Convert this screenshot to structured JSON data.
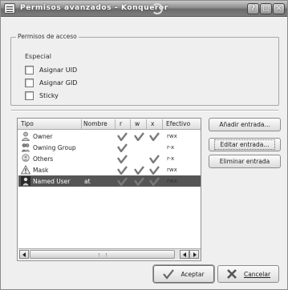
{
  "window": {
    "title": "Permisos avanzados - Konqueror",
    "buttons": {
      "help": "?",
      "maximize": "□",
      "close": "✕"
    }
  },
  "access_group": {
    "title": "Permisos de acceso",
    "special_label": "Especial",
    "checkboxes": [
      {
        "label": "Asignar UID",
        "checked": false
      },
      {
        "label": "Asignar GID",
        "checked": false
      },
      {
        "label": "Sticky",
        "checked": false
      }
    ]
  },
  "table": {
    "columns": [
      "Tipo",
      "Nombre",
      "r",
      "w",
      "x",
      "Efectivo"
    ],
    "rows": [
      {
        "tipo": "Owner",
        "nombre": "",
        "r": true,
        "w": true,
        "x": true,
        "efectivo": "rwx",
        "icon": "user-icon",
        "selected": false
      },
      {
        "tipo": "Owning Group",
        "nombre": "",
        "r": true,
        "w": false,
        "x": false,
        "efectivo": "r-x",
        "icon": "group-icon",
        "selected": false
      },
      {
        "tipo": "Others",
        "nombre": "",
        "r": true,
        "w": false,
        "x": true,
        "efectivo": "r-x",
        "icon": "others-icon",
        "selected": false
      },
      {
        "tipo": "Mask",
        "nombre": "",
        "r": true,
        "w": true,
        "x": true,
        "efectivo": "rwx",
        "icon": "warning-icon",
        "selected": false
      },
      {
        "tipo": "Named User",
        "nombre": "at",
        "r": true,
        "w": true,
        "x": true,
        "efectivo": "rwx",
        "icon": "named-user-icon",
        "selected": true
      }
    ]
  },
  "side_buttons": {
    "add": "Añadir entrada...",
    "edit": "Editar entrada...",
    "delete": "Eliminar entrada"
  },
  "dialog_buttons": {
    "ok": "Aceptar",
    "cancel": "Cancelar"
  },
  "colors": {
    "selection": "#555555",
    "check": "#7a7a7a"
  }
}
